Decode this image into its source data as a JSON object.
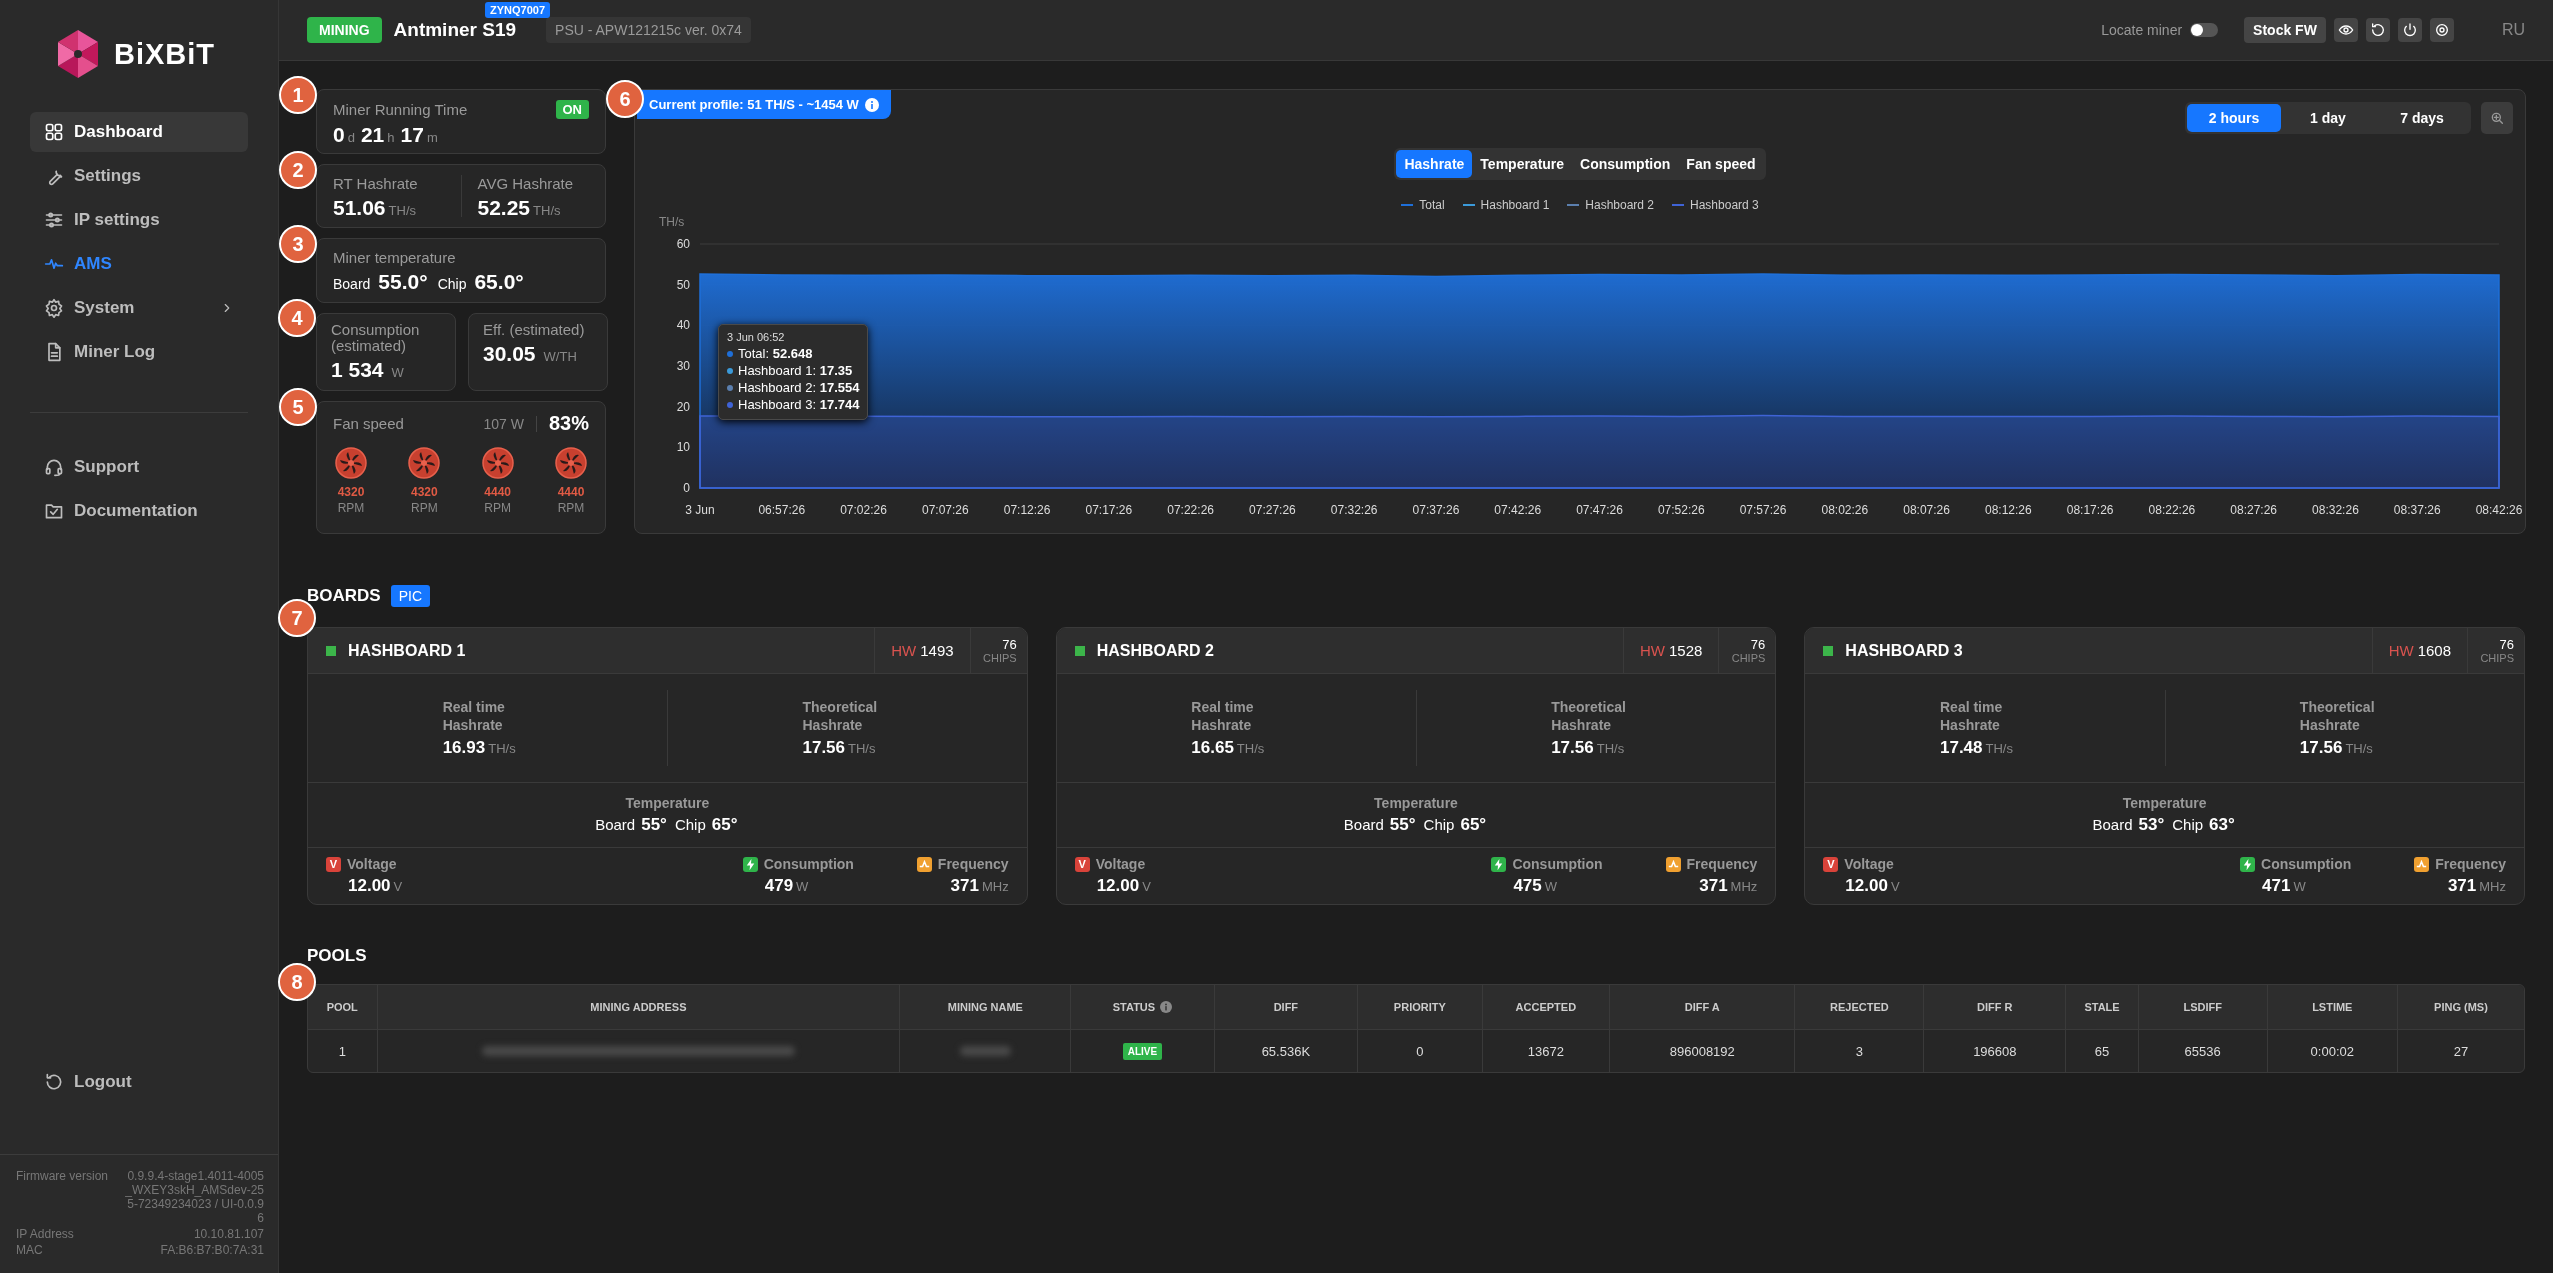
{
  "sidebar": {
    "logo": "BiXBiT",
    "items": [
      {
        "label": "Dashboard",
        "selected": true,
        "kind": "page"
      },
      {
        "label": "Settings",
        "selected": false,
        "kind": "page"
      },
      {
        "label": "IP settings",
        "selected": false,
        "kind": "page"
      },
      {
        "label": "AMS",
        "selected": false,
        "kind": "accent"
      },
      {
        "label": "System",
        "selected": false,
        "kind": "submenu"
      },
      {
        "label": "Miner Log",
        "selected": false,
        "kind": "page"
      }
    ],
    "links": [
      {
        "label": "Support"
      },
      {
        "label": "Documentation"
      }
    ],
    "logout": "Logout",
    "info": [
      {
        "label": "Firmware version",
        "value": "0.9.9.4-stage1.4011-4005_WXEY3skH_AMSdev-255-72349234023 / UI-0.0.96"
      },
      {
        "label": "IP Address",
        "value": "10.10.81.107"
      },
      {
        "label": "MAC",
        "value": "FA:B6:B7:B0:7A:31"
      }
    ]
  },
  "header": {
    "status": "MINING",
    "model": "Antminer S19",
    "board_type": "ZYNQ7007",
    "psu": "PSU - APW121215c ver. 0x74",
    "locate": {
      "label": "Locate miner",
      "on": false
    },
    "firmware_button": "Stock FW",
    "language": {
      "label": "RU",
      "selected": false
    }
  },
  "summary": {
    "runtime": {
      "badge": "1",
      "title": "Miner Running Time",
      "state": "ON",
      "parts": [
        {
          "value": "0",
          "unit": "d"
        },
        {
          "value": "21",
          "unit": "h"
        },
        {
          "value": "17",
          "unit": "m"
        }
      ]
    },
    "hashrate": {
      "badge": "2",
      "items": [
        {
          "label": "RT Hashrate",
          "value": "51.06",
          "unit": "TH/s"
        },
        {
          "label": "AVG Hashrate",
          "value": "52.25",
          "unit": "TH/s"
        }
      ]
    },
    "temperature": {
      "badge": "3",
      "title": "Miner temperature",
      "board_label": "Board",
      "board": "55.0°",
      "chip_label": "Chip",
      "chip": "65.0°"
    },
    "power": {
      "badge": "4",
      "items": [
        {
          "label": "Consumption (estimated)",
          "value": "1 534",
          "unit": "W"
        },
        {
          "label": "Eff. (estimated)",
          "value": "30.05",
          "unit": "W/TH"
        }
      ]
    },
    "fans": {
      "badge": "5",
      "title": "Fan speed",
      "power": "107 W",
      "percent": "83%",
      "items": [
        {
          "rpm": "4320",
          "unit": "RPM"
        },
        {
          "rpm": "4320",
          "unit": "RPM"
        },
        {
          "rpm": "4440",
          "unit": "RPM"
        },
        {
          "rpm": "4440",
          "unit": "RPM"
        }
      ]
    }
  },
  "chart_panel": {
    "badge": "6",
    "profile": "Current profile: 51 TH/S - ~1454 W",
    "ranges": [
      {
        "label": "2 hours",
        "selected": true
      },
      {
        "label": "1 day",
        "selected": false
      },
      {
        "label": "7 days",
        "selected": false
      }
    ],
    "metrics": [
      {
        "label": "Hashrate",
        "selected": true
      },
      {
        "label": "Temperature",
        "selected": false
      },
      {
        "label": "Consumption",
        "selected": false
      },
      {
        "label": "Fan speed",
        "selected": false
      }
    ],
    "tooltip": {
      "title": "3 Jun 06:52",
      "rows": [
        "Total: **52.648**",
        "Hashboard 1: **17.35**",
        "Hashboard 2: **17.554**",
        "Hashboard 3: **17.744**"
      ]
    },
    "chart_data": {
      "type": "area",
      "stacked": false,
      "ylabel": "TH/s",
      "ylim": [
        0,
        60
      ],
      "yticks": [
        0,
        10,
        20,
        30,
        40,
        50,
        60
      ],
      "categories": [
        "3 Jun",
        "06:57:26",
        "07:02:26",
        "07:07:26",
        "07:12:26",
        "07:17:26",
        "07:22:26",
        "07:27:26",
        "07:32:26",
        "07:37:26",
        "07:42:26",
        "07:47:26",
        "07:52:26",
        "07:57:26",
        "08:02:26",
        "08:07:26",
        "08:12:26",
        "08:17:26",
        "08:22:26",
        "08:27:26",
        "08:32:26",
        "08:37:26",
        "08:42:26"
      ],
      "series": [
        {
          "name": "Total",
          "color": "#1e6fd9",
          "values": [
            52.6,
            52.4,
            52.3,
            52.4,
            52.2,
            52.2,
            52.3,
            52.2,
            52.3,
            52.0,
            52.3,
            52.5,
            52.4,
            52.6,
            52.3,
            52.4,
            52.3,
            52.4,
            52.5,
            52.4,
            52.2,
            52.5,
            52.4
          ]
        },
        {
          "name": "Hashboard 1",
          "color": "#3b9ad9",
          "values": [
            null,
            null,
            null,
            null,
            null,
            null,
            null,
            null,
            null,
            null,
            null,
            null,
            null,
            null,
            null,
            null,
            null,
            null,
            null,
            null,
            null,
            null,
            null
          ]
        },
        {
          "name": "Hashboard 2",
          "color": "#5b7fae",
          "values": [
            null,
            null,
            null,
            null,
            null,
            null,
            null,
            null,
            null,
            null,
            null,
            null,
            null,
            null,
            null,
            null,
            null,
            null,
            null,
            null,
            null,
            null,
            null
          ]
        },
        {
          "name": "Hashboard 3",
          "color": "#3f63d6",
          "values": [
            17.7,
            null,
            null,
            17.6,
            17.5,
            17.5,
            17.6,
            17.5,
            17.6,
            17.5,
            17.6,
            17.7,
            17.6,
            17.8,
            17.6,
            17.6,
            17.6,
            17.6,
            17.7,
            17.6,
            17.5,
            17.7,
            17.6
          ]
        }
      ]
    }
  },
  "boards": {
    "title": "BOARDS",
    "tag": "PIC",
    "badge": "7",
    "items": [
      {
        "name": "HASHBOARD 1",
        "color": "#3cb54a",
        "hw_label": "HW",
        "hw": "1493",
        "chips": "76",
        "chips_label": "CHIPS",
        "realtime": {
          "label": "Real time Hashrate",
          "value": "16.93",
          "unit": "TH/s"
        },
        "theoretical": {
          "label": "Theoretical Hashrate",
          "value": "17.56",
          "unit": "TH/s"
        },
        "temperature": {
          "label": "Temperature",
          "board_label": "Board",
          "board": "55°",
          "chip_label": "Chip",
          "chip": "65°"
        },
        "metrics": [
          {
            "kind": "voltage",
            "symbol": "V",
            "label": "Voltage",
            "value": "12.00",
            "unit": "V"
          },
          {
            "kind": "consumption",
            "label": "Consumption",
            "value": "479",
            "unit": "W"
          },
          {
            "kind": "frequency",
            "label": "Frequency",
            "value": "371",
            "unit": "MHz"
          }
        ]
      },
      {
        "name": "HASHBOARD 2",
        "color": "#3cb54a",
        "hw_label": "HW",
        "hw": "1528",
        "chips": "76",
        "chips_label": "CHIPS",
        "realtime": {
          "label": "Real time Hashrate",
          "value": "16.65",
          "unit": "TH/s"
        },
        "theoretical": {
          "label": "Theoretical Hashrate",
          "value": "17.56",
          "unit": "TH/s"
        },
        "temperature": {
          "label": "Temperature",
          "board_label": "Board",
          "board": "55°",
          "chip_label": "Chip",
          "chip": "65°"
        },
        "metrics": [
          {
            "kind": "voltage",
            "symbol": "V",
            "label": "Voltage",
            "value": "12.00",
            "unit": "V"
          },
          {
            "kind": "consumption",
            "label": "Consumption",
            "value": "475",
            "unit": "W"
          },
          {
            "kind": "frequency",
            "label": "Frequency",
            "value": "371",
            "unit": "MHz"
          }
        ]
      },
      {
        "name": "HASHBOARD 3",
        "color": "#3cb54a",
        "hw_label": "HW",
        "hw": "1608",
        "chips": "76",
        "chips_label": "CHIPS",
        "realtime": {
          "label": "Real time Hashrate",
          "value": "17.48",
          "unit": "TH/s"
        },
        "theoretical": {
          "label": "Theoretical Hashrate",
          "value": "17.56",
          "unit": "TH/s"
        },
        "temperature": {
          "label": "Temperature",
          "board_label": "Board",
          "board": "53°",
          "chip_label": "Chip",
          "chip": "63°"
        },
        "metrics": [
          {
            "kind": "voltage",
            "symbol": "V",
            "label": "Voltage",
            "value": "12.00",
            "unit": "V"
          },
          {
            "kind": "consumption",
            "label": "Consumption",
            "value": "471",
            "unit": "W"
          },
          {
            "kind": "frequency",
            "label": "Frequency",
            "value": "371",
            "unit": "MHz"
          }
        ]
      }
    ]
  },
  "pools": {
    "title": "POOLS",
    "badge": "8",
    "columns": [
      {
        "label": "POOL"
      },
      {
        "label": "MINING ADDRESS"
      },
      {
        "label": "MINING NAME"
      },
      {
        "label": "STATUS",
        "info": true
      },
      {
        "label": "DIFF"
      },
      {
        "label": "PRIORITY"
      },
      {
        "label": "ACCEPTED"
      },
      {
        "label": "DIFF A"
      },
      {
        "label": "REJECTED"
      },
      {
        "label": "DIFF R"
      },
      {
        "label": "STALE"
      },
      {
        "label": "LSDIFF"
      },
      {
        "label": "LSTIME"
      },
      {
        "label": "PING (MS)"
      }
    ],
    "rows": [
      {
        "cells": [
          {
            "kind": "text",
            "text": "1"
          },
          {
            "kind": "blurred"
          },
          {
            "kind": "blurred"
          },
          {
            "kind": "status",
            "text": "ALIVE"
          },
          {
            "kind": "text",
            "text": "65.536K"
          },
          {
            "kind": "text",
            "text": "0"
          },
          {
            "kind": "text",
            "text": "13672"
          },
          {
            "kind": "text",
            "text": "896008192"
          },
          {
            "kind": "text",
            "text": "3"
          },
          {
            "kind": "text",
            "text": "196608"
          },
          {
            "kind": "text",
            "text": "65"
          },
          {
            "kind": "text",
            "text": "65536"
          },
          {
            "kind": "text",
            "text": "0:00:02"
          },
          {
            "kind": "text",
            "text": "27"
          }
        ]
      }
    ]
  }
}
